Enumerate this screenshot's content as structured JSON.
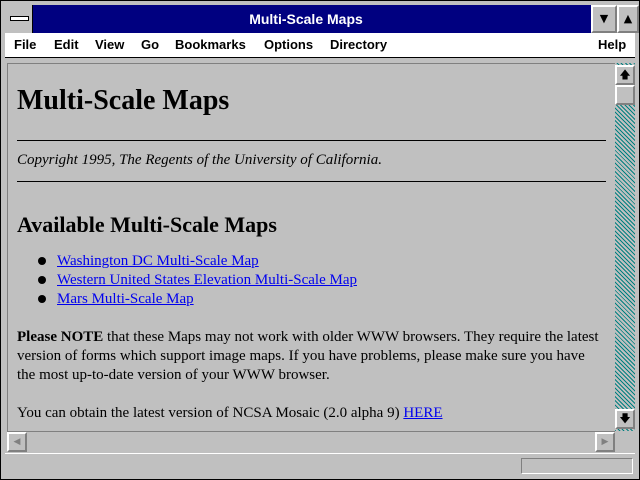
{
  "window": {
    "title": "Multi-Scale Maps",
    "minimize_glyph": "▼",
    "maximize_glyph": "▲"
  },
  "menu": {
    "file": "File",
    "edit": "Edit",
    "view": "View",
    "go": "Go",
    "bookmarks": "Bookmarks",
    "options": "Options",
    "directory": "Directory",
    "help": "Help"
  },
  "page": {
    "heading": "Multi-Scale Maps",
    "copyright": "Copyright 1995, The Regents of the University of California.",
    "subheading": "Available Multi-Scale Maps",
    "maps": [
      {
        "label": "Washington DC Multi-Scale Map"
      },
      {
        "label": "Western United States Elevation Multi-Scale Map"
      },
      {
        "label": "Mars Multi-Scale Map"
      }
    ],
    "note_bold": "Please NOTE",
    "note_text": " that these Maps may not work with older WWW browsers. They require the latest version of forms which support image maps. If you have problems, please make sure you have the most up-to-date version of your WWW browser.",
    "obtain_text": "You can obtain the latest version of NCSA Mosaic (2.0 alpha 9) ",
    "obtain_link": "HERE"
  },
  "scrollbars": {
    "up_glyph": "🡅",
    "down_glyph": "🡇",
    "left_glyph": "◀",
    "right_glyph": "▶"
  },
  "status": {
    "text": ""
  }
}
